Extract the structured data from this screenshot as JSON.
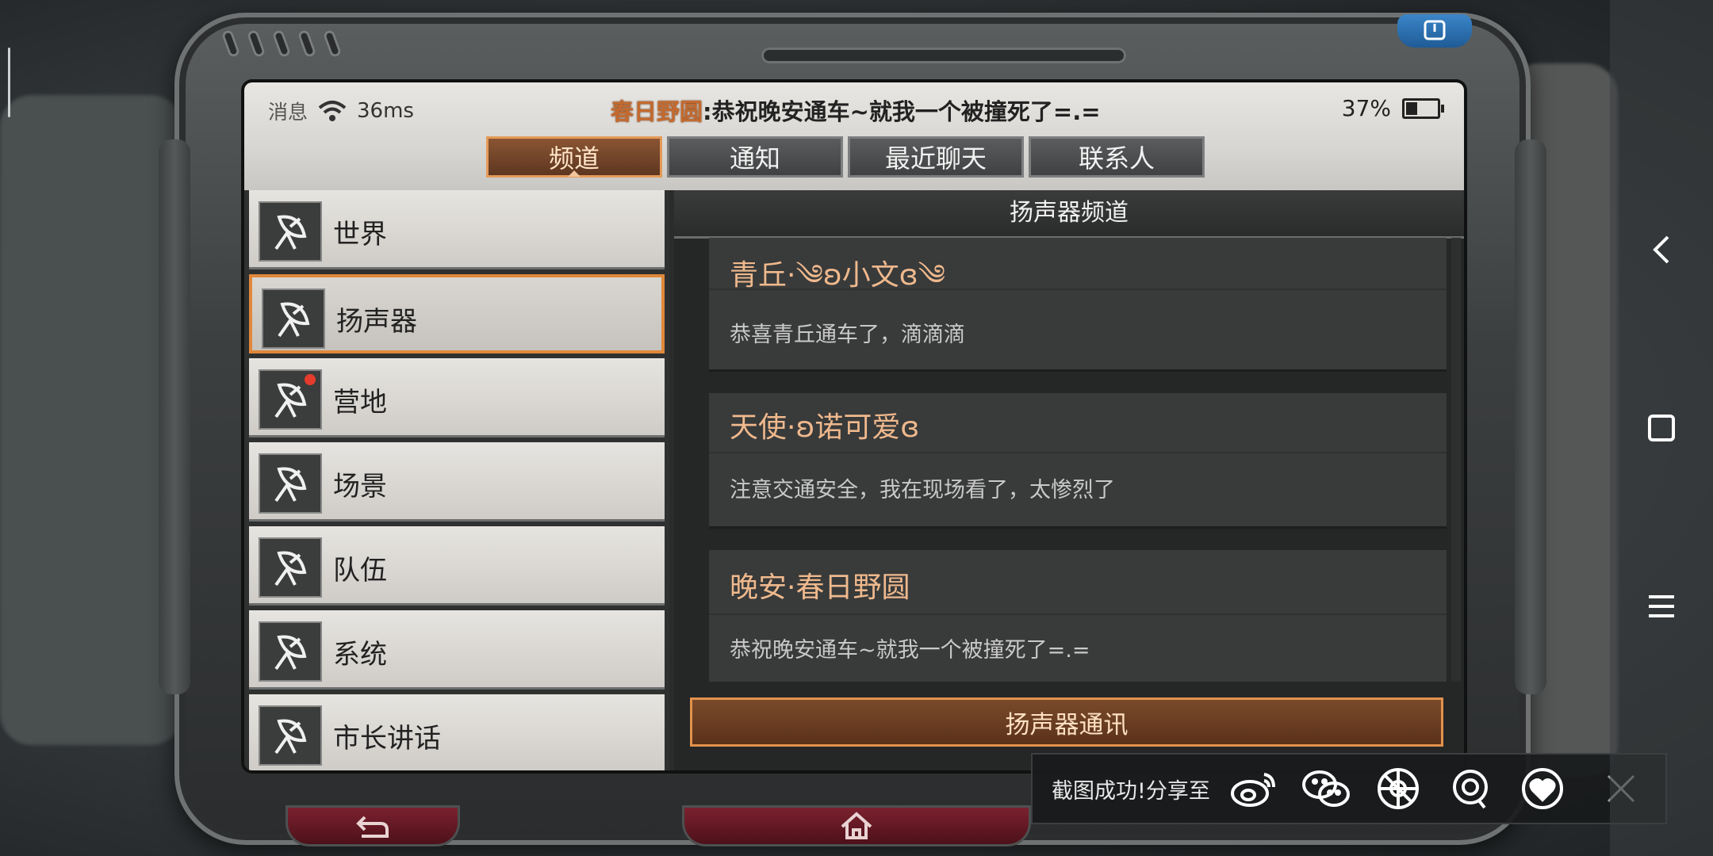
{
  "status": {
    "messages_label": "消息",
    "ping": "36ms",
    "marquee_sender": "春日野圆",
    "marquee_text": ":恭祝晚安通车~就我一个被撞死了=.=",
    "battery_percent": "37%",
    "battery_level": 0.37
  },
  "tabs": [
    {
      "label": "频道",
      "active": true
    },
    {
      "label": "通知",
      "active": false
    },
    {
      "label": "最近聊天",
      "active": false
    },
    {
      "label": "联系人",
      "active": false
    }
  ],
  "channels": [
    {
      "label": "世界",
      "active": false,
      "badge": false
    },
    {
      "label": "扬声器",
      "active": true,
      "badge": false
    },
    {
      "label": "营地",
      "active": false,
      "badge": true
    },
    {
      "label": "场景",
      "active": false,
      "badge": false
    },
    {
      "label": "队伍",
      "active": false,
      "badge": false
    },
    {
      "label": "系统",
      "active": false,
      "badge": false
    },
    {
      "label": "市长讲话",
      "active": false,
      "badge": false
    }
  ],
  "pane": {
    "title": "扬声器频道",
    "send_button": "扬声器通讯"
  },
  "messages": [
    {
      "name": "青丘·༄ʚ小文ɞ༄",
      "text": "恭喜青丘通车了，滴滴滴"
    },
    {
      "name": "天使·ʚ诺可爱ɞ",
      "text": "注意交通安全，我在现场看了，太惨烈了"
    },
    {
      "name": "晚安·春日野圆",
      "text": "恭祝晚安通车~就我一个被撞死了=.="
    }
  ],
  "share": {
    "label": "截图成功!分享至",
    "targets": [
      "weibo-icon",
      "wechat-icon",
      "moments-icon",
      "qq-icon",
      "qzone-icon"
    ]
  },
  "colors": {
    "accent": "#e0883a",
    "name_text": "#efb98d",
    "badge": "#e53b2c"
  }
}
